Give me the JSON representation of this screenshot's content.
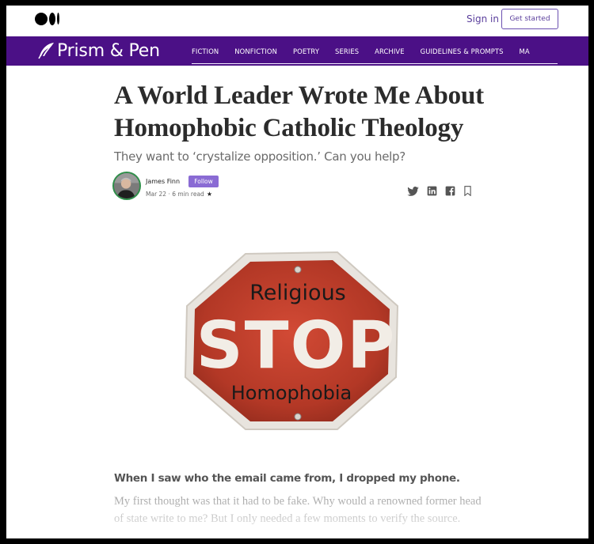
{
  "topbar": {
    "sign_in": "Sign in",
    "get_started": "Get started"
  },
  "publication": {
    "name": "Prism & Pen",
    "nav": [
      "FICTION",
      "NONFICTION",
      "POETRY",
      "SERIES",
      "ARCHIVE",
      "GUIDELINES & PROMPTS",
      "MA"
    ],
    "bar_color": "#4b1086"
  },
  "article": {
    "title": "A World Leader Wrote Me About Homophobic Catholic Theology",
    "subtitle": "They want to ‘crystalize opposition.’ Can you help?",
    "author": "James Finn",
    "follow": "Follow",
    "meta": "Mar 22 · 6 min read",
    "share_icons": [
      "twitter-icon",
      "linkedin-icon",
      "facebook-icon",
      "bookmark-icon"
    ],
    "image": {
      "top_text": "Religious",
      "center_text": "STOP",
      "bottom_text": "Homophobia"
    },
    "lead": "When I saw who the email came from, I dropped my phone.",
    "paragraph": "My first thought was that it had to be fake. Why would a renowned former head of state write to me? But I only needed a few moments to verify the source."
  }
}
